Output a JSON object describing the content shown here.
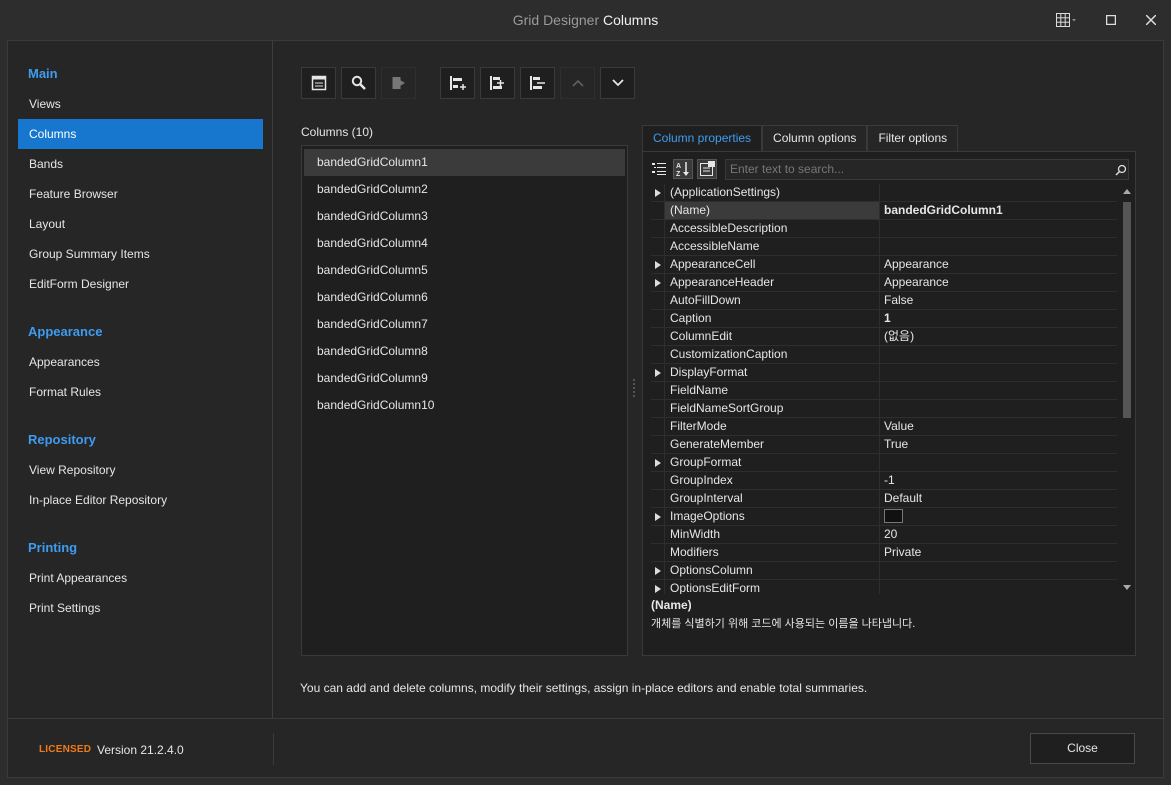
{
  "window": {
    "title_prefix": "Grid Designer",
    "title_main": "Columns"
  },
  "sidebar": {
    "groups": [
      {
        "label": "Main",
        "items": [
          "Views",
          "Columns",
          "Bands",
          "Feature Browser",
          "Layout",
          "Group Summary Items",
          "EditForm Designer"
        ]
      },
      {
        "label": "Appearance",
        "items": [
          "Appearances",
          "Format Rules"
        ]
      },
      {
        "label": "Repository",
        "items": [
          "View Repository",
          "In-place Editor Repository"
        ]
      },
      {
        "label": "Printing",
        "items": [
          "Print Appearances",
          "Print Settings"
        ]
      }
    ],
    "active_item": "Columns"
  },
  "columns": {
    "label": "Columns (10)",
    "items": [
      "bandedGridColumn1",
      "bandedGridColumn2",
      "bandedGridColumn3",
      "bandedGridColumn4",
      "bandedGridColumn5",
      "bandedGridColumn6",
      "bandedGridColumn7",
      "bandedGridColumn8",
      "bandedGridColumn9",
      "bandedGridColumn10"
    ],
    "selected": "bandedGridColumn1"
  },
  "tabs": [
    "Column properties",
    "Column options",
    "Filter options"
  ],
  "search": {
    "placeholder": "Enter text to search..."
  },
  "properties": [
    {
      "name": "(ApplicationSettings)",
      "value": "",
      "expandable": true
    },
    {
      "name": "(Name)",
      "value": "bandedGridColumn1",
      "bold": true,
      "selected": true
    },
    {
      "name": "AccessibleDescription",
      "value": ""
    },
    {
      "name": "AccessibleName",
      "value": ""
    },
    {
      "name": "AppearanceCell",
      "value": "Appearance",
      "expandable": true
    },
    {
      "name": "AppearanceHeader",
      "value": "Appearance",
      "expandable": true
    },
    {
      "name": "AutoFillDown",
      "value": "False"
    },
    {
      "name": "Caption",
      "value": "1",
      "bold": true
    },
    {
      "name": "ColumnEdit",
      "value": "(없음)"
    },
    {
      "name": "CustomizationCaption",
      "value": ""
    },
    {
      "name": "DisplayFormat",
      "value": "",
      "expandable": true
    },
    {
      "name": "FieldName",
      "value": ""
    },
    {
      "name": "FieldNameSortGroup",
      "value": ""
    },
    {
      "name": "FilterMode",
      "value": "Value"
    },
    {
      "name": "GenerateMember",
      "value": "True"
    },
    {
      "name": "GroupFormat",
      "value": "",
      "expandable": true
    },
    {
      "name": "GroupIndex",
      "value": "-1"
    },
    {
      "name": "GroupInterval",
      "value": "Default"
    },
    {
      "name": "ImageOptions",
      "value": "",
      "expandable": true,
      "swatch": true
    },
    {
      "name": "MinWidth",
      "value": "20"
    },
    {
      "name": "Modifiers",
      "value": "Private"
    },
    {
      "name": "OptionsColumn",
      "value": "",
      "expandable": true
    },
    {
      "name": "OptionsEditForm",
      "value": "",
      "expandable": true
    }
  ],
  "description": {
    "title": "(Name)",
    "text": "개체를 식별하기 위해 코드에 사용되는 이름을 나타냅니다."
  },
  "hint": "You can add and delete columns, modify their settings, assign in-place editors and enable total summaries.",
  "footer": {
    "licensed": "LICENSED",
    "version": "Version 21.2.4.0",
    "close_label": "Close"
  },
  "colors": {
    "accent": "#1777cf",
    "group_header": "#3e9cf0",
    "licensed": "#f07a1a"
  }
}
